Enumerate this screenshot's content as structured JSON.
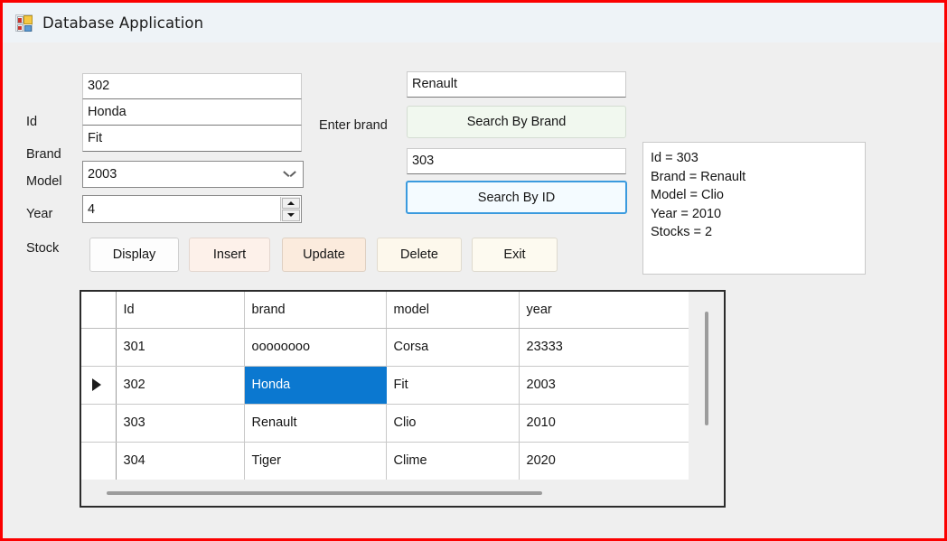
{
  "window": {
    "title": "Database Application",
    "icon": "winforms-app-icon",
    "border_color": "#fb0000",
    "titlebar_color": "#eef3f7",
    "body_color": "#efefef"
  },
  "form": {
    "fields": [
      {
        "label": "Id",
        "value": "302",
        "control": "textbox"
      },
      {
        "label": "Brand",
        "value": "Honda",
        "control": "textbox"
      },
      {
        "label": "Model",
        "value": "Fit",
        "control": "textbox"
      },
      {
        "label": "Year",
        "value": "2003",
        "control": "combobox"
      },
      {
        "label": "Stock",
        "value": "4",
        "control": "numeric-updown"
      }
    ]
  },
  "search": {
    "brand_label": "Enter brand",
    "brand_value": "Renault",
    "search_brand_button": "Search By Brand",
    "id_value": "303",
    "search_id_button": "Search By ID",
    "search_id_focused": true,
    "search_brand_color": "#f1f8ef",
    "search_id_border_color": "#3a9ade"
  },
  "actions": {
    "buttons": [
      {
        "label": "Display",
        "tint": "#fdfdfd"
      },
      {
        "label": "Insert",
        "tint": "#fdf1ea"
      },
      {
        "label": "Update",
        "tint": "#fbebdd"
      },
      {
        "label": "Delete",
        "tint": "#fdf8ec"
      },
      {
        "label": "Exit",
        "tint": "#fdfaf0"
      }
    ]
  },
  "result_panel": {
    "lines": [
      "Id = 303",
      "Brand = Renault",
      "Model = Clio",
      "Year = 2010",
      "Stocks = 2"
    ]
  },
  "grid": {
    "columns": [
      "",
      "Id",
      "brand",
      "model",
      "year"
    ],
    "selected_cell": {
      "row": 1,
      "column": "brand",
      "value": "Honda",
      "color": "#0b78d0"
    },
    "current_row_marker": 1,
    "rows": [
      {
        "marker": false,
        "Id": "301",
        "brand": "oooooooo",
        "model": "Corsa",
        "year": "23333"
      },
      {
        "marker": true,
        "Id": "302",
        "brand": "Honda",
        "model": "Fit",
        "year": "2003"
      },
      {
        "marker": false,
        "Id": "303",
        "brand": "Renault",
        "model": "Clio",
        "year": "2010"
      },
      {
        "marker": false,
        "Id": "304",
        "brand": "Tiger",
        "model": "Clime",
        "year": "2020"
      },
      {
        "marker": false,
        "Id": "",
        "brand": "",
        "model": "",
        "year": ""
      }
    ],
    "vertical_scrollbar": {
      "thumb_fraction": 0.66
    },
    "horizontal_scrollbar": {
      "thumb_fraction": 0.78
    }
  }
}
